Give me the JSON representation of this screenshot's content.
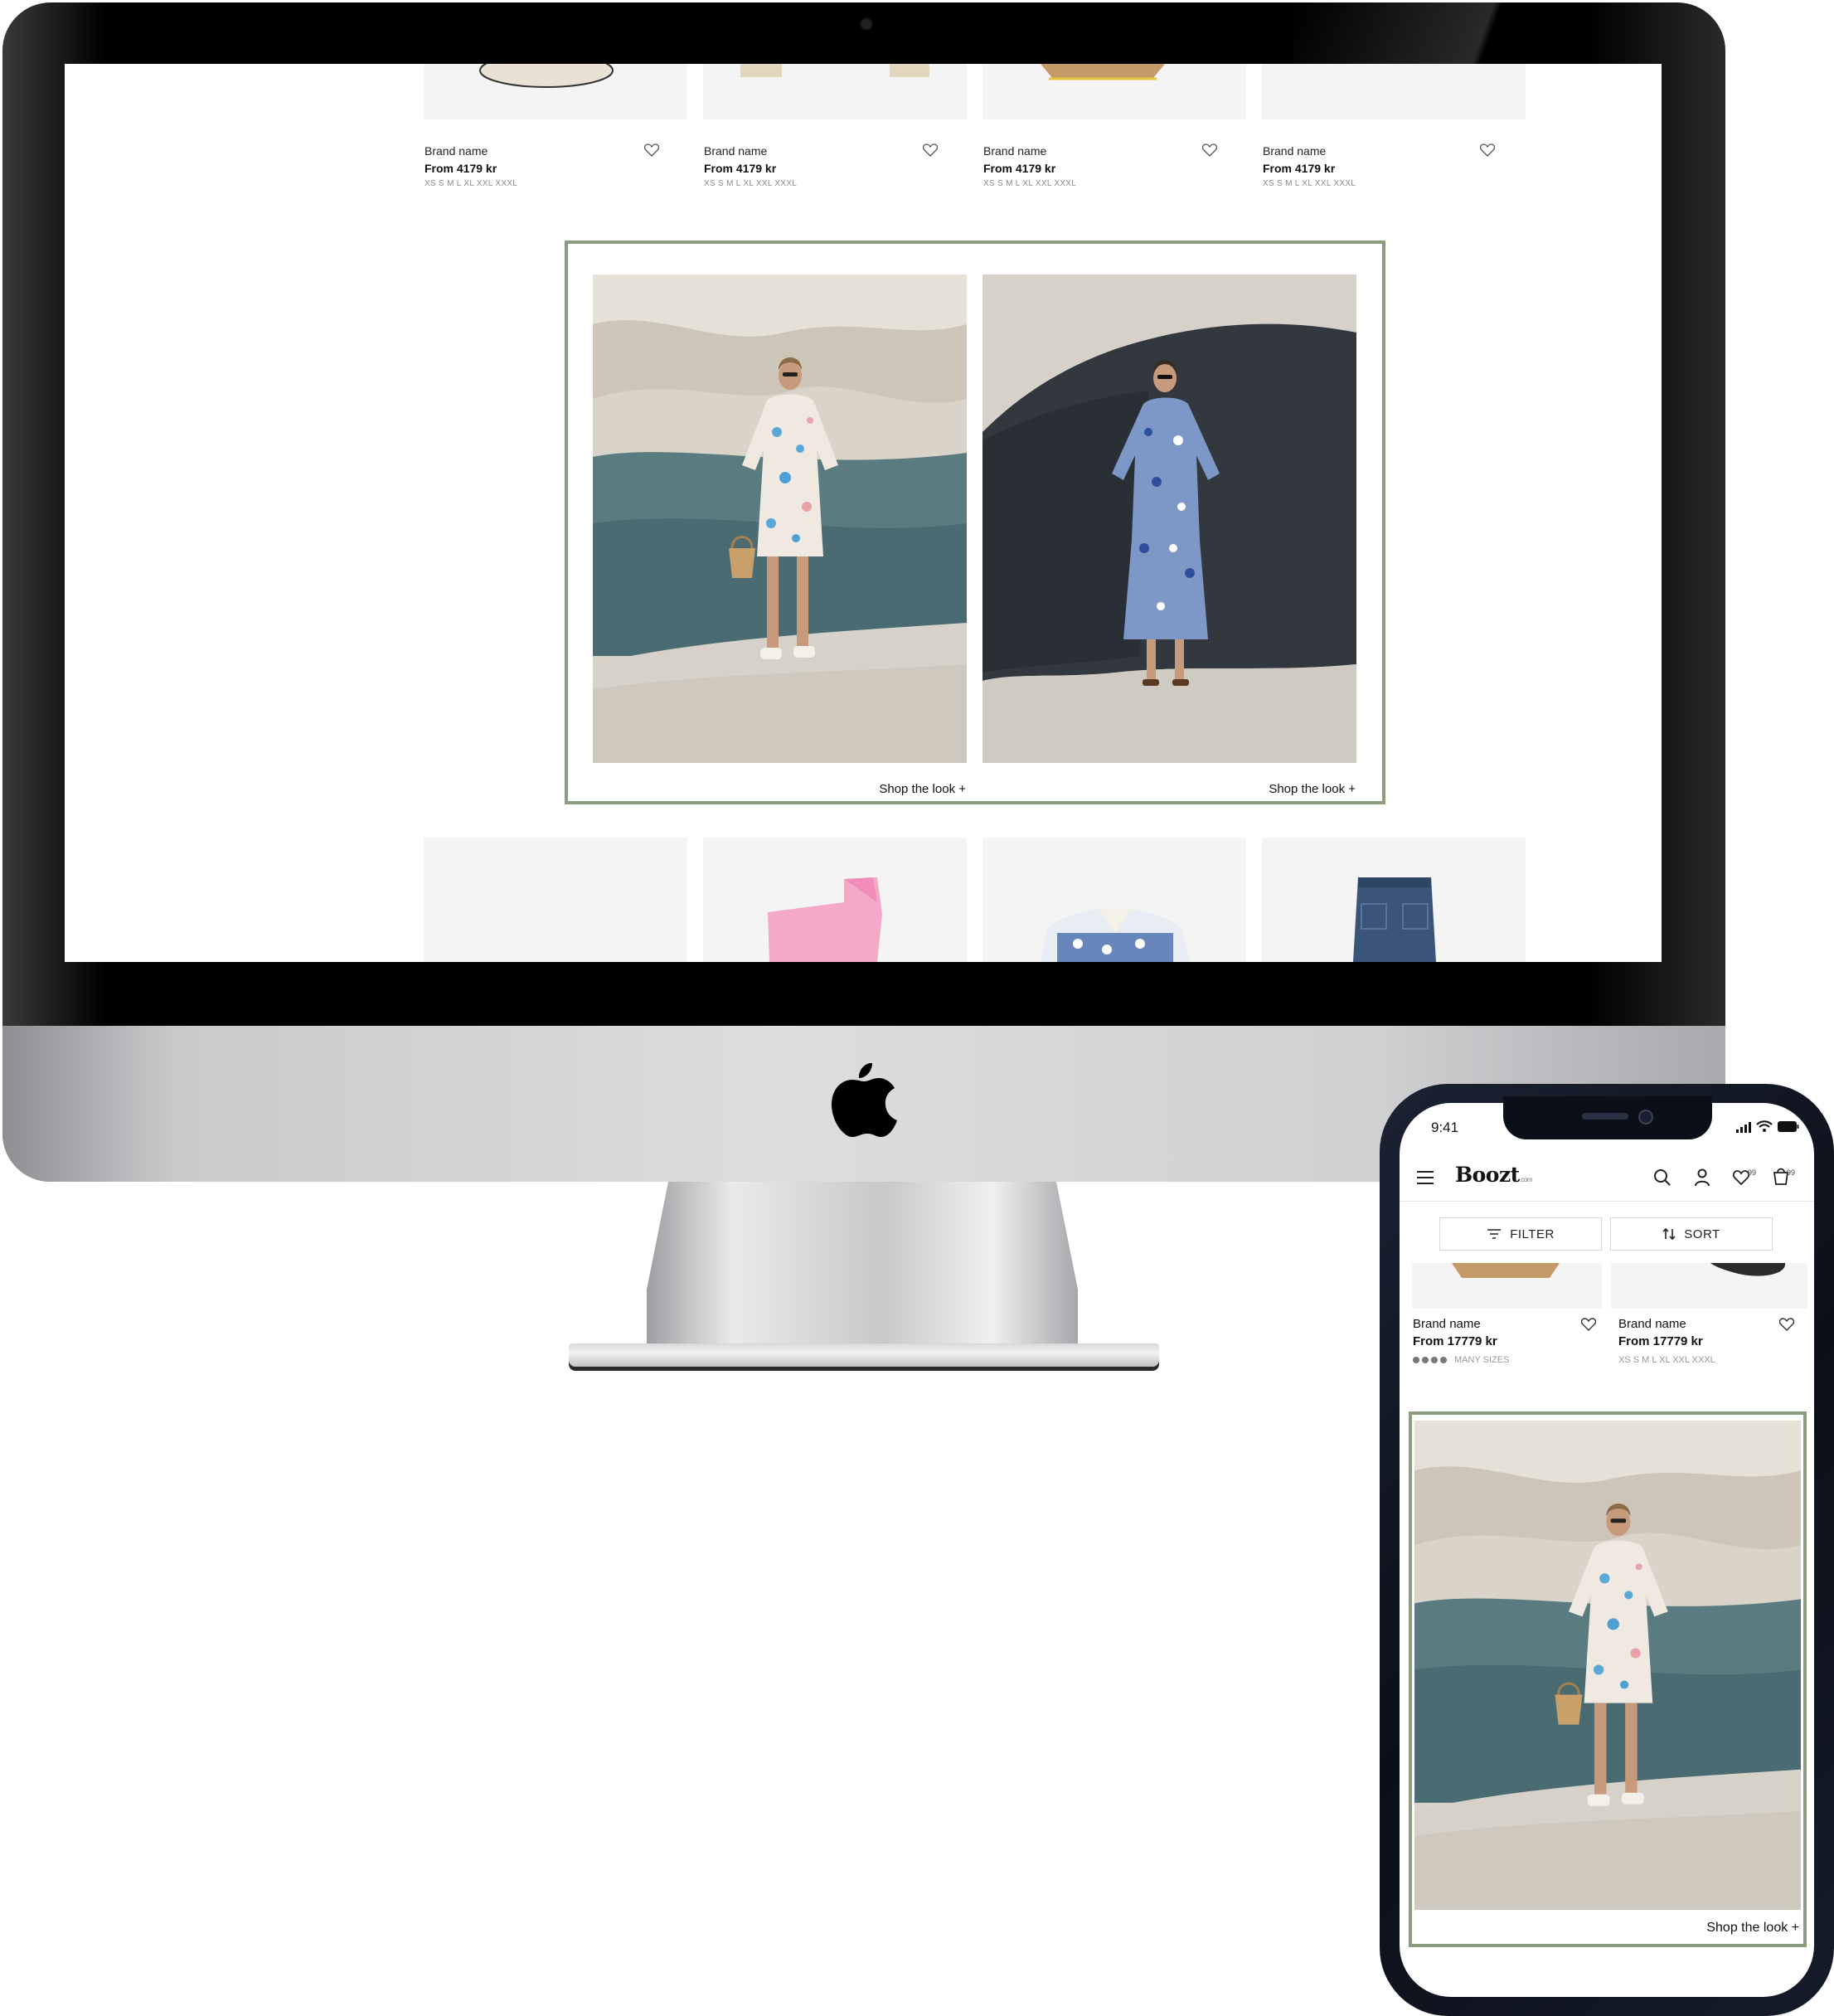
{
  "desktop": {
    "products_top": [
      {
        "brand": "Brand name",
        "price": "From 4179 kr",
        "sizes": "XS S M L XL XXL XXXL"
      },
      {
        "brand": "Brand name",
        "price": "From 4179 kr",
        "sizes": "XS S M L XL XXL XXXL"
      },
      {
        "brand": "Brand name",
        "price": "From 4179 kr",
        "sizes": "XS S M L XL XXL XXXL"
      },
      {
        "brand": "Brand name",
        "price": "From 4179 kr",
        "sizes": "XS S M L XL XXL XXXL"
      }
    ],
    "looks": [
      {
        "label": "Shop the look +"
      },
      {
        "label": "Shop the look +"
      }
    ]
  },
  "mobile": {
    "status": {
      "time": "9:41"
    },
    "header": {
      "logo": "Boozt",
      "logo_suffix": ".com",
      "wishlist_count": "99",
      "cart_count": "99"
    },
    "toolbar": {
      "filter_label": "FILTER",
      "sort_label": "SORT"
    },
    "products": [
      {
        "brand": "Brand name",
        "price": "From 17779 kr",
        "sizes": "MANY SIZES"
      },
      {
        "brand": "Brand name",
        "price": "From 17779 kr",
        "sizes": "XS S M L XL XXL XXXL"
      }
    ],
    "look": {
      "label": "Shop the look +"
    }
  },
  "colors": {
    "look_border": "#8b9c7f",
    "thumb_bg": "#f4f4f4",
    "phone_frame": "#0b0f18"
  }
}
